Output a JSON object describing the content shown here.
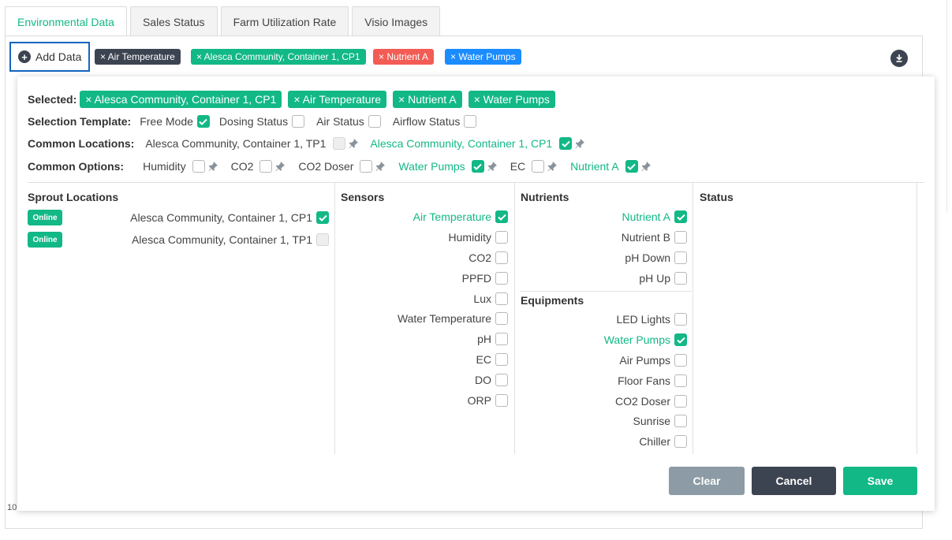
{
  "tabs": [
    {
      "label": "Environmental Data",
      "active": true
    },
    {
      "label": "Sales Status"
    },
    {
      "label": "Farm Utilization Rate"
    },
    {
      "label": "Visio Images"
    }
  ],
  "toolbar": {
    "add_data_label": "Add Data",
    "chips": [
      {
        "label": "× Air Temperature",
        "color": "#3d4451"
      },
      {
        "label": "× Alesca Community, Container 1, CP1",
        "color": "#12b886"
      },
      {
        "label": "× Nutrient A",
        "color": "#f25c54"
      },
      {
        "label": "× Water Pumps",
        "color": "#1a8cff"
      }
    ],
    "download_icon": "download-icon"
  },
  "background": {
    "axis_label": "10"
  },
  "panel": {
    "selected_label": "Selected:",
    "selected_chips": [
      "× Alesca Community, Container 1, CP1",
      "× Air Temperature",
      "× Nutrient A",
      "× Water Pumps"
    ],
    "selection_template": {
      "label": "Selection Template:",
      "options": [
        {
          "label": "Free Mode",
          "checked": true
        },
        {
          "label": "Dosing Status",
          "checked": false
        },
        {
          "label": "Air Status",
          "checked": false
        },
        {
          "label": "Airflow Status",
          "checked": false
        }
      ]
    },
    "common_locations": {
      "label": "Common Locations:",
      "options": [
        {
          "label": "Alesca Community, Container 1, TP1",
          "checked": false,
          "disabled": true
        },
        {
          "label": "Alesca Community, Container 1, CP1",
          "checked": true
        }
      ]
    },
    "common_options": {
      "label": "Common Options:",
      "options": [
        {
          "label": "Humidity",
          "checked": false
        },
        {
          "label": "CO2",
          "checked": false
        },
        {
          "label": "CO2 Doser",
          "checked": false
        },
        {
          "label": "Water Pumps",
          "checked": true
        },
        {
          "label": "EC",
          "checked": false
        },
        {
          "label": "Nutrient A",
          "checked": true
        }
      ]
    },
    "sprout_locations": {
      "title": "Sprout Locations",
      "items": [
        {
          "status": "Online",
          "label": "Alesca Community, Container 1, CP1",
          "checked": true
        },
        {
          "status": "Online",
          "label": "Alesca Community, Container 1, TP1",
          "checked": false,
          "disabled": true
        }
      ]
    },
    "sensors": {
      "title": "Sensors",
      "items": [
        {
          "label": "Air Temperature",
          "checked": true
        },
        {
          "label": "Humidity",
          "checked": false
        },
        {
          "label": "CO2",
          "checked": false
        },
        {
          "label": "PPFD",
          "checked": false
        },
        {
          "label": "Lux",
          "checked": false
        },
        {
          "label": "Water Temperature",
          "checked": false
        },
        {
          "label": "pH",
          "checked": false
        },
        {
          "label": "EC",
          "checked": false
        },
        {
          "label": "DO",
          "checked": false
        },
        {
          "label": "ORP",
          "checked": false
        }
      ]
    },
    "nutrients": {
      "title": "Nutrients",
      "items": [
        {
          "label": "Nutrient A",
          "checked": true
        },
        {
          "label": "Nutrient B",
          "checked": false
        },
        {
          "label": "pH Down",
          "checked": false
        },
        {
          "label": "pH Up",
          "checked": false
        }
      ]
    },
    "equipments": {
      "title": "Equipments",
      "items": [
        {
          "label": "LED Lights",
          "checked": false
        },
        {
          "label": "Water Pumps",
          "checked": true
        },
        {
          "label": "Air Pumps",
          "checked": false
        },
        {
          "label": "Floor Fans",
          "checked": false
        },
        {
          "label": "CO2 Doser",
          "checked": false
        },
        {
          "label": "Sunrise",
          "checked": false
        },
        {
          "label": "Chiller",
          "checked": false
        }
      ]
    },
    "status": {
      "title": "Status"
    },
    "buttons": {
      "clear": "Clear",
      "cancel": "Cancel",
      "save": "Save"
    },
    "colors": {
      "accent": "#12b886",
      "dark": "#3d4451",
      "clear_btn": "#8c9ba5"
    }
  }
}
